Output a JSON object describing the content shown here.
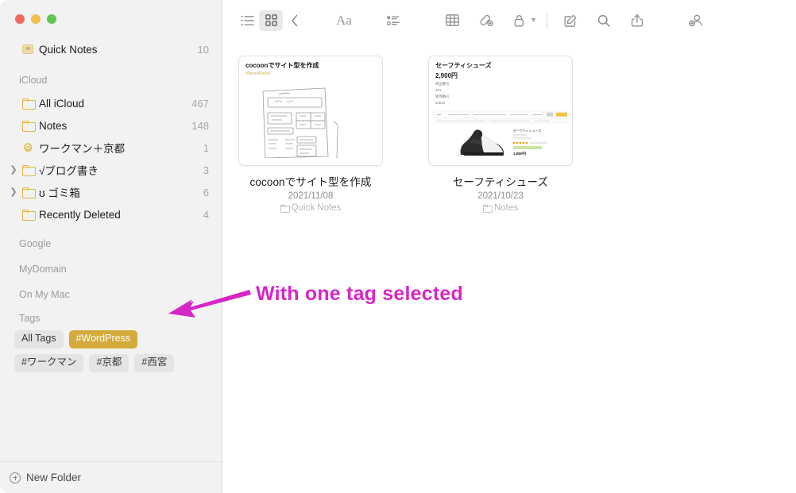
{
  "window": {
    "traffic_lights": [
      "close",
      "minimize",
      "zoom"
    ],
    "colors": {
      "close": "#ec6a5f",
      "minimize": "#f4bf4f",
      "zoom": "#61c454",
      "accent_tag": "#d3ab3a",
      "annotation": "#d726c7",
      "folder_icon": "#e3b53f"
    }
  },
  "toolbar": {
    "items": [
      {
        "name": "list-view-button",
        "icon": "list-view-icon",
        "active": false
      },
      {
        "name": "gallery-view-button",
        "icon": "gallery-view-icon",
        "active": true
      },
      {
        "name": "back-button",
        "icon": "chevron-left-icon",
        "active": false
      },
      {
        "name": "format-button",
        "icon": "aa-format-icon",
        "label": "Aa",
        "active": false
      },
      {
        "name": "checklist-button",
        "icon": "checklist-icon",
        "active": false
      },
      {
        "name": "table-button",
        "icon": "table-icon",
        "active": false
      },
      {
        "name": "add-link-button",
        "icon": "link-add-icon",
        "active": false
      },
      {
        "name": "lock-button",
        "icon": "lock-icon",
        "active": false
      },
      {
        "name": "compose-button",
        "icon": "compose-note-icon",
        "active": false
      },
      {
        "name": "search-button",
        "icon": "search-icon",
        "active": false
      },
      {
        "name": "share-button",
        "icon": "share-icon",
        "active": false
      },
      {
        "name": "collaborate-button",
        "icon": "add-collaborator-icon",
        "active": false
      }
    ]
  },
  "sidebar": {
    "top_items": [
      {
        "label": "Quick Notes",
        "count": "10",
        "icon": "quick-notes-icon",
        "expandable": false
      }
    ],
    "sections": [
      {
        "title": "iCloud",
        "items": [
          {
            "label": "All iCloud",
            "count": "467",
            "icon": "folder-icon",
            "expandable": false
          },
          {
            "label": "Notes",
            "count": "148",
            "icon": "folder-icon",
            "expandable": false
          },
          {
            "label": "ワークマン＋京都",
            "count": "1",
            "icon": "gear-icon",
            "expandable": false
          },
          {
            "label": "√ブログ書き",
            "count": "3",
            "icon": "folder-icon",
            "expandable": true
          },
          {
            "label": "ʊ ゴミ箱",
            "count": "6",
            "icon": "folder-icon",
            "expandable": true
          },
          {
            "label": "Recently Deleted",
            "count": "4",
            "icon": "folder-icon",
            "expandable": false
          }
        ]
      },
      {
        "title": "Google",
        "items": []
      },
      {
        "title": "MyDomain",
        "items": []
      },
      {
        "title": "On My Mac",
        "items": []
      }
    ],
    "tags_section_title": "Tags",
    "tags": [
      {
        "label": "All Tags",
        "selected": false
      },
      {
        "label": "#WordPress",
        "selected": true
      },
      {
        "label": "#ワークマン",
        "selected": false
      },
      {
        "label": "#京都",
        "selected": false
      },
      {
        "label": "#西宮",
        "selected": false
      }
    ],
    "new_folder_label": "New Folder"
  },
  "notes": [
    {
      "title": "cocoonでサイト型を作成",
      "date": "2021/11/08",
      "folder": "Quick Notes",
      "preview": {
        "heading": "cocoonでサイト型を作成",
        "tag": "#WordPress",
        "body_type": "hand-drawn-wireframe-sketch"
      }
    },
    {
      "title": "セーフティシューズ",
      "date": "2021/10/23",
      "folder": "Notes",
      "preview": {
        "heading": "セーフティシューズ",
        "price": "2,900円",
        "lines": [
          "商品番号",
          "101",
          "管理番号",
          "53034"
        ],
        "body_type": "product-page-screenshot-sneaker"
      }
    }
  ],
  "annotation": {
    "text": "With one tag selected",
    "arrow": "arrow-pointing-left-to-tags"
  }
}
